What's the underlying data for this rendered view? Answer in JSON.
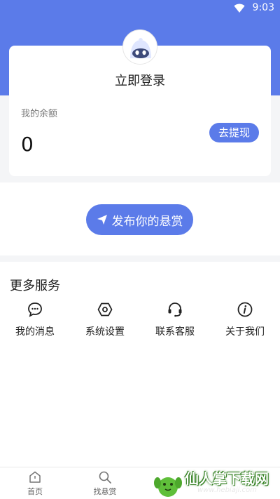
{
  "status_bar": {
    "time": "9:03"
  },
  "account": {
    "login_label": "立即登录",
    "balance_label": "我的余额",
    "balance_value": "0",
    "withdraw_label": "去提现"
  },
  "publish": {
    "label": "发布你的悬赏"
  },
  "services": {
    "title": "更多服务",
    "items": [
      {
        "label": "我的消息",
        "icon": "message-icon"
      },
      {
        "label": "系统设置",
        "icon": "settings-icon"
      },
      {
        "label": "联系客服",
        "icon": "headset-icon"
      },
      {
        "label": "关于我们",
        "icon": "info-icon"
      }
    ]
  },
  "bottom_nav": {
    "items": [
      {
        "label": "首页",
        "icon": "home-icon"
      },
      {
        "label": "找悬赏",
        "icon": "search-icon"
      }
    ]
  },
  "watermark": {
    "text": "仙人掌下载网",
    "url": "www.hebiaji.com"
  },
  "colors": {
    "accent": "#5b7be9"
  }
}
